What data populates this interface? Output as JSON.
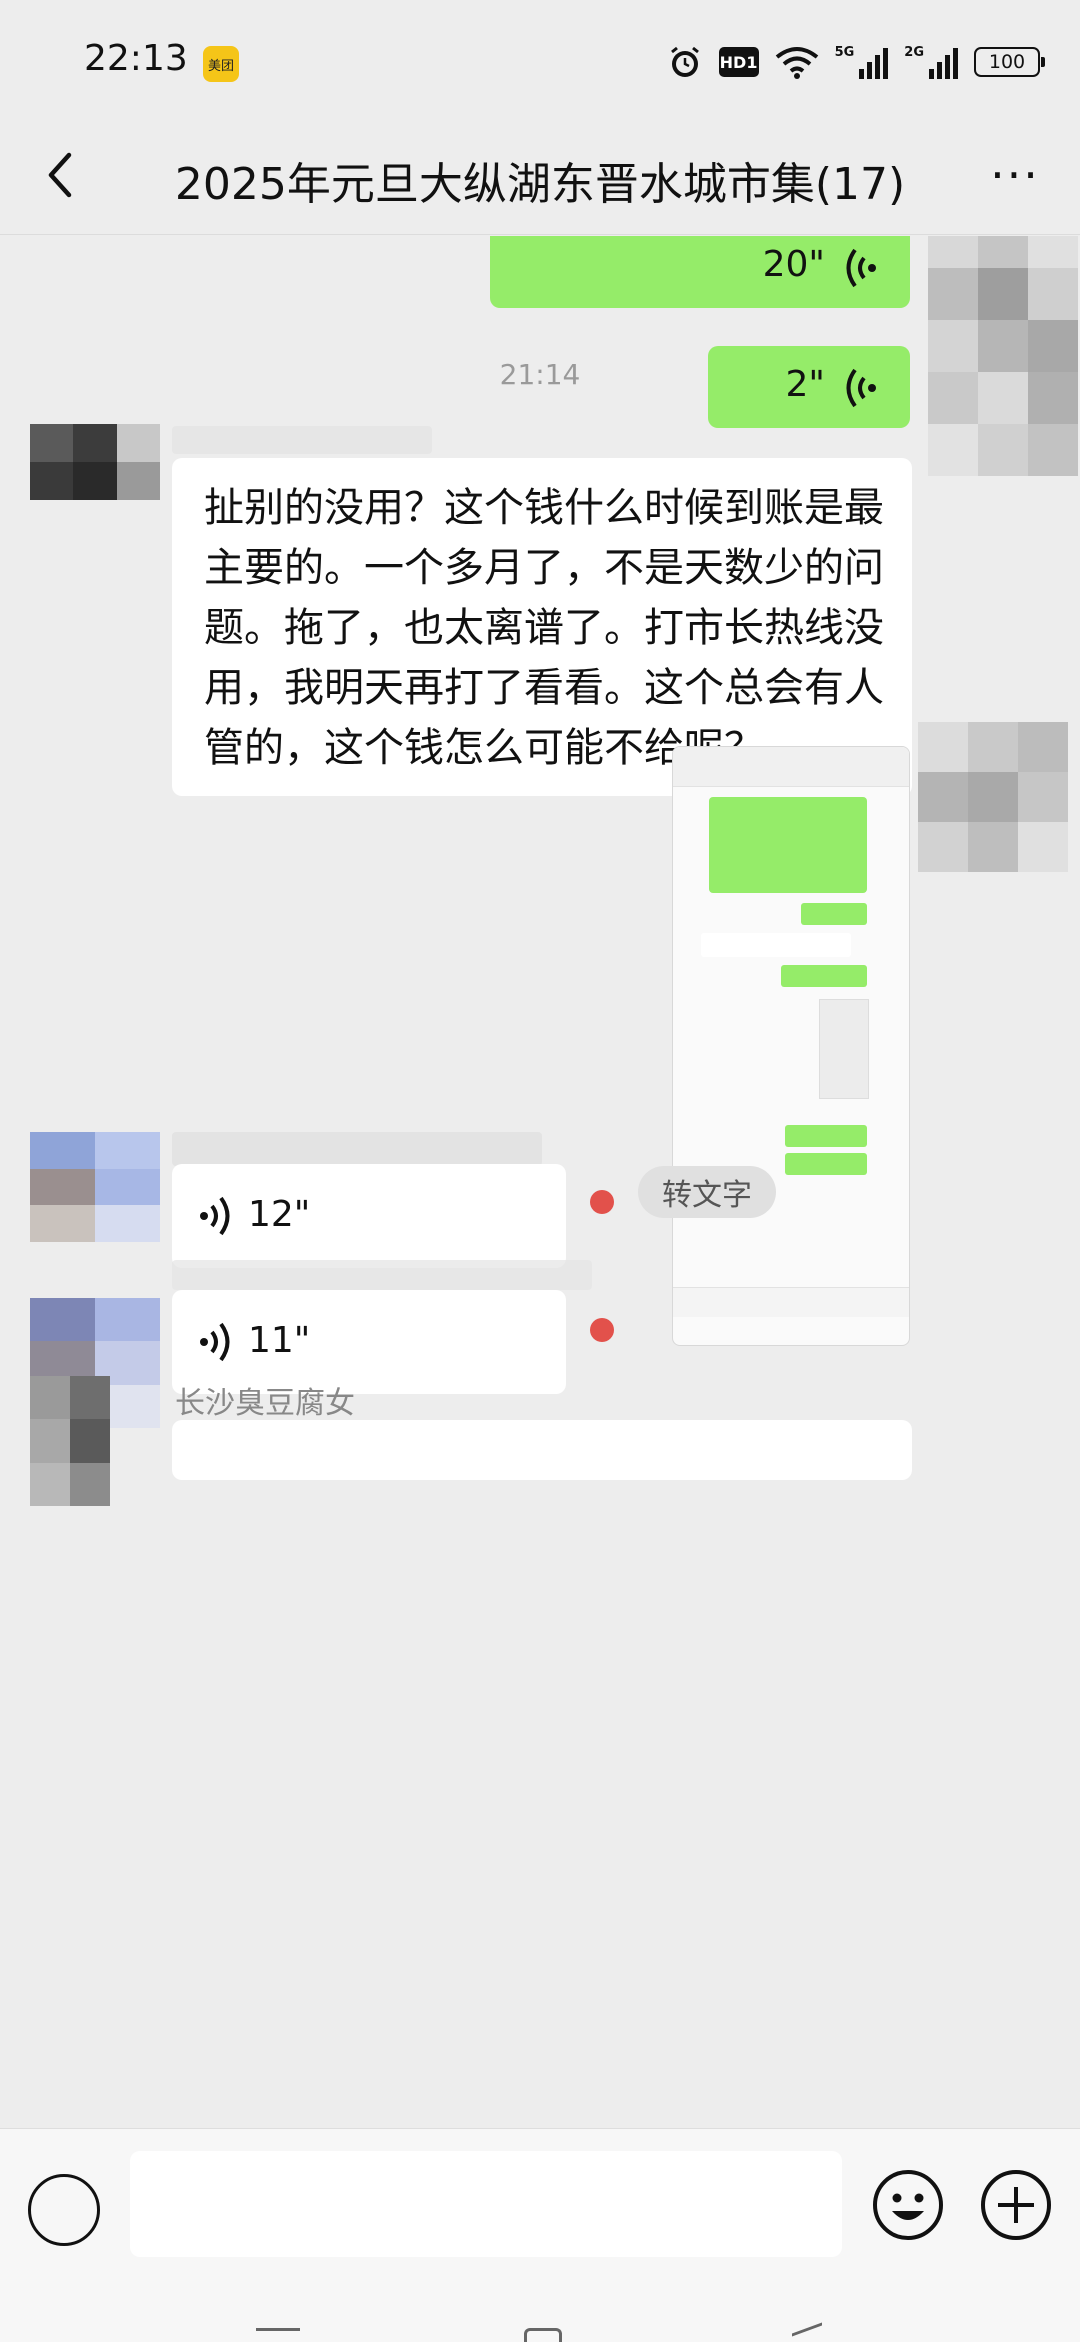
{
  "status_bar": {
    "time": "22:13",
    "app_badge": "美团",
    "hd_label": "HD1",
    "signal_1": "5G",
    "signal_2": "2G",
    "battery": "100"
  },
  "header": {
    "title": "2025年元旦大纵湖东晋水城市集(17)",
    "more": "···"
  },
  "messages": {
    "voice_out_1": "20\"",
    "voice_out_2": "2\"",
    "timestamp": "21:14",
    "text_in_1": "扯别的没用？这个钱什么时候到账是最主要的。一个多月了，不是天数少的问题。拖了，也太离谱了。打市长热线没用，我明天再打了看看。这个总会有人管的，这个钱怎么可能不给呢？",
    "voice_in_1": "12\"",
    "to_text_label": "转文字",
    "voice_in_2": "11\"",
    "last_sender": "长沙臭豆腐女"
  },
  "colors": {
    "outgoing_bubble": "#95ec69",
    "incoming_bubble": "#ffffff",
    "background": "#ededed",
    "unread_dot": "#e2514b"
  }
}
